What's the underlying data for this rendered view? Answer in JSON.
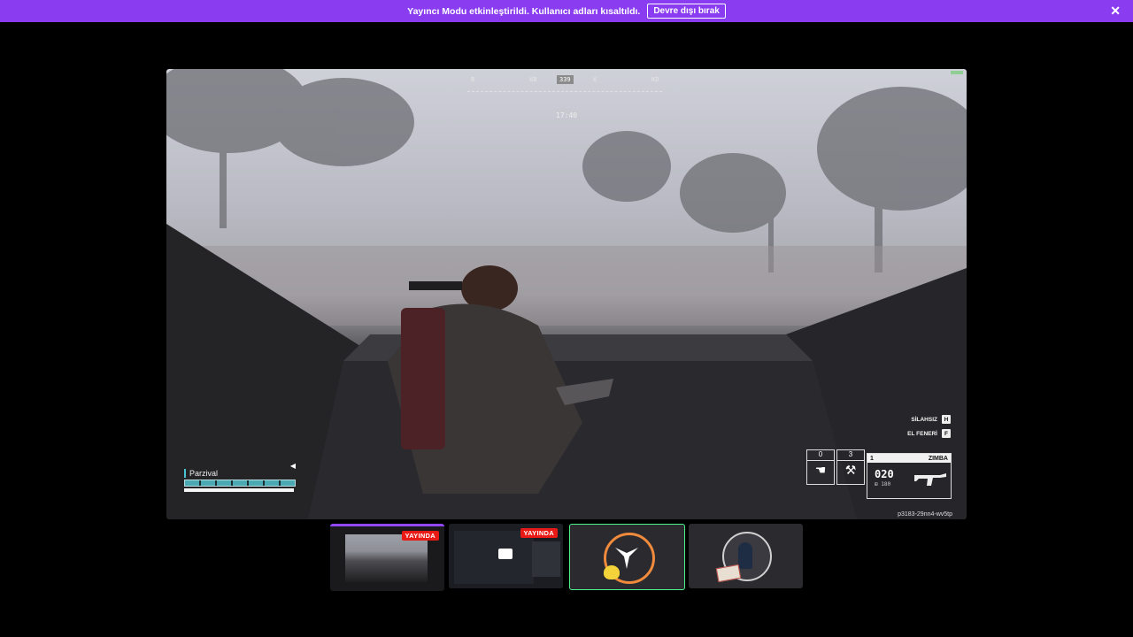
{
  "banner": {
    "message": "Yayıncı Modu etkinleştirildi. Kullanıcı adları kısaltıldı.",
    "disable_label": "Devre dışı bırak",
    "close_symbol": "✕",
    "color": "#8a3df0"
  },
  "game_hud": {
    "compass": {
      "markers": [
        "B",
        "KB",
        "K",
        "KD"
      ],
      "heading": "339"
    },
    "clock": "17:40",
    "player": {
      "name": "Parzival"
    },
    "prompts": [
      {
        "label": "SİLAHSIZ",
        "key": "H"
      },
      {
        "label": "EL FENERİ",
        "key": "F"
      }
    ],
    "slots": [
      {
        "count": "0",
        "icon": "hand-icon"
      },
      {
        "count": "3",
        "icon": "pickaxe-icon"
      }
    ],
    "weapon": {
      "slot": "1",
      "name": "ZIMBA",
      "ammo": "020",
      "reserve": "180"
    },
    "session_id": "p3183-29nn4-wv5tp"
  },
  "thumbnails": [
    {
      "badge": "YAYINDA",
      "kind": "game"
    },
    {
      "badge": "YAYINDA",
      "kind": "screen"
    },
    {
      "badge": "",
      "kind": "avatar"
    },
    {
      "badge": "",
      "kind": "avatar"
    }
  ]
}
